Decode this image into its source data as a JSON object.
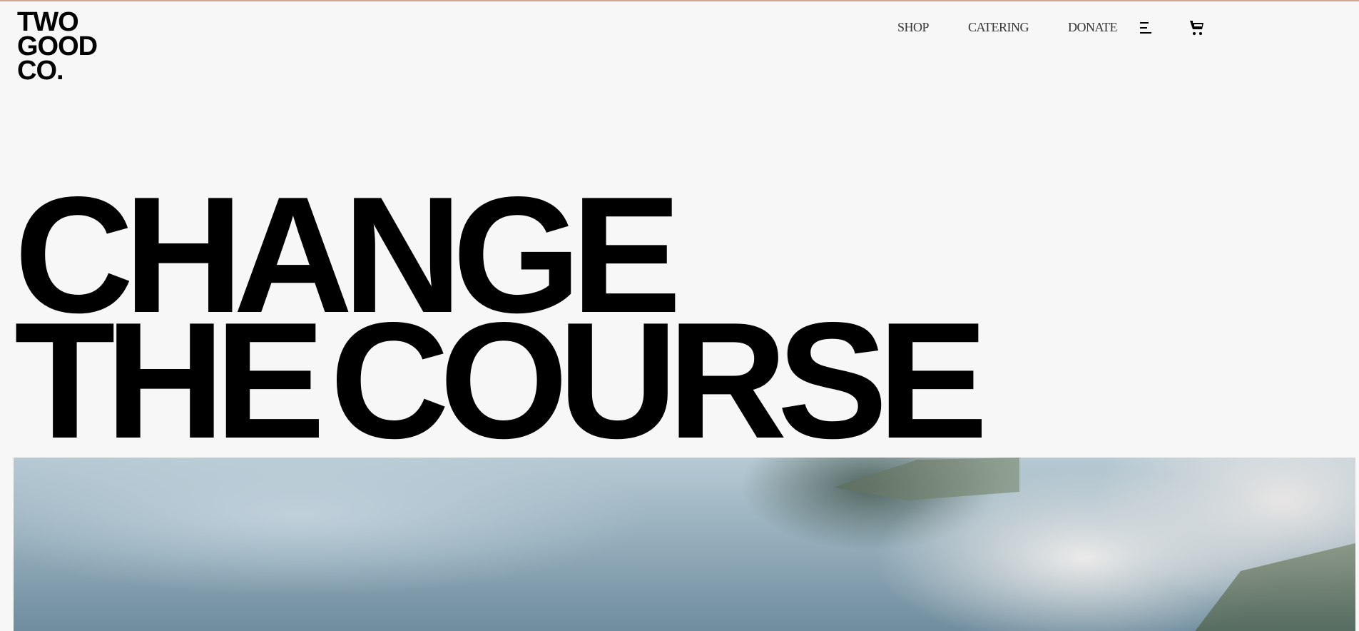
{
  "brand": {
    "logo_lines": [
      "TWO",
      "GOOD",
      "CO."
    ]
  },
  "nav": {
    "items": [
      "SHOP",
      "CATERING",
      "DONATE"
    ]
  },
  "icons": {
    "menu": "menu-icon",
    "cart": "cart-icon"
  },
  "hero": {
    "lines": [
      "CHANGE",
      "THE COURSE"
    ]
  },
  "colors": {
    "background": "#f7f7f7",
    "top_border": "#d4a590",
    "text": "#000000"
  }
}
